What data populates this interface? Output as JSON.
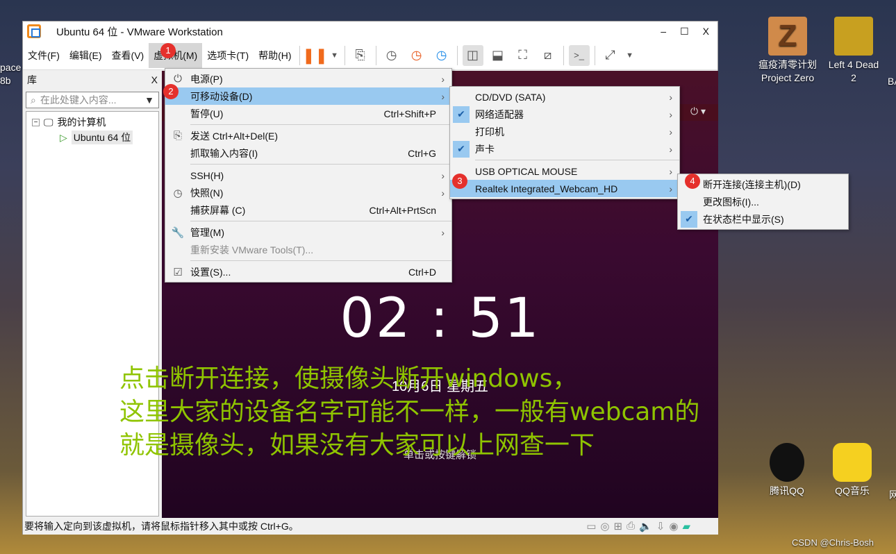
{
  "desktop": {
    "icons": [
      {
        "label1": "瘟疫清零计划",
        "label2": "Project Zero"
      },
      {
        "label1": "Left 4 Dead",
        "label2": "2"
      },
      {
        "label1": "腾讯QQ"
      },
      {
        "label1": "QQ音乐"
      }
    ],
    "left_edge_labels": [
      "pace",
      "8b"
    ],
    "right_edge_labels": [
      "BA",
      "网"
    ],
    "watermark": "CSDN @Chris-Bosh"
  },
  "window": {
    "title": "Ubuntu 64 位 - VMware Workstation",
    "controls": {
      "minimize": "–",
      "maximize": "☐",
      "close": "X"
    },
    "menu": [
      "文件(F)",
      "编辑(E)",
      "查看(V)",
      "虚拟机(M)",
      "选项卡(T)",
      "帮助(H)"
    ],
    "accent": "#f08a1c"
  },
  "library": {
    "title": "库",
    "close": "X",
    "search_placeholder": "在此处键入内容...",
    "tree": {
      "root": "我的计算机",
      "child": "Ubuntu 64 位"
    }
  },
  "vm_menu": [
    {
      "label": "电源(P)",
      "arrow": true,
      "icon": "power-icon"
    },
    {
      "label": "可移动设备(D)",
      "arrow": true,
      "highlight": true
    },
    {
      "label": "暂停(U)",
      "shortcut": "Ctrl+Shift+P"
    },
    {
      "label": "发送 Ctrl+Alt+Del(E)",
      "icon": "send-keys-icon"
    },
    {
      "label": "抓取输入内容(I)",
      "shortcut": "Ctrl+G"
    },
    {
      "label": "SSH(H)",
      "arrow": true
    },
    {
      "label": "快照(N)",
      "arrow": true,
      "icon": "snapshot-icon"
    },
    {
      "label": "捕获屏幕 (C)",
      "shortcut": "Ctrl+Alt+PrtScn"
    },
    {
      "label": "管理(M)",
      "arrow": true,
      "icon": "wrench-icon"
    },
    {
      "label": "重新安装 VMware Tools(T)...",
      "disabled": true
    },
    {
      "label": "设置(S)...",
      "shortcut": "Ctrl+D",
      "icon": "settings-icon"
    }
  ],
  "devices_menu": [
    {
      "label": "CD/DVD (SATA)",
      "checked": false
    },
    {
      "label": "网络适配器",
      "checked": true
    },
    {
      "label": "打印机",
      "checked": false
    },
    {
      "label": "声卡",
      "checked": true
    },
    {
      "label": "USB OPTICAL MOUSE",
      "checked": false
    },
    {
      "label": "Realtek Integrated_Webcam_HD",
      "checked": false,
      "highlight": true
    }
  ],
  "webcam_menu": [
    {
      "label": "断开连接(连接主机)(D)",
      "checked": false
    },
    {
      "label": "更改图标(I)...",
      "checked": false
    },
    {
      "label": "在状态栏中显示(S)",
      "checked": true
    }
  ],
  "badges": [
    "1",
    "2",
    "3",
    "4"
  ],
  "guest": {
    "clock": "02 : 51",
    "date": "10月6日 星期五",
    "unlock": "单击或按键解锁"
  },
  "annotation": {
    "lines": [
      "点击断开连接，使摄像头断开windows，",
      "这里大家的设备名字可能不一样，一般有webcam的",
      "就是摄像头，如果没有大家可以上网查一下"
    ],
    "color": "#8fc400"
  },
  "status": {
    "text": "要将输入定向到该虚拟机，请将鼠标指针移入其中或按 Ctrl+G。"
  }
}
